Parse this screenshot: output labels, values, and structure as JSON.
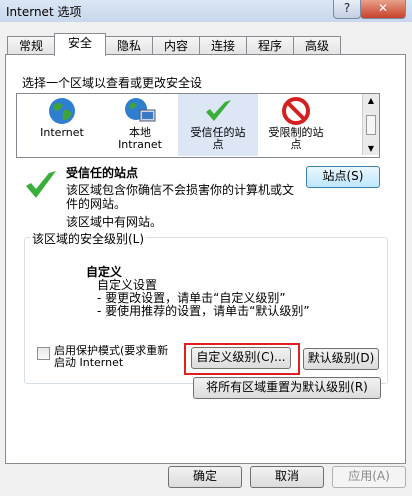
{
  "window": {
    "title": "Internet 选项",
    "help": "?",
    "close": "✕"
  },
  "tabs": [
    "常规",
    "安全",
    "隐私",
    "内容",
    "连接",
    "程序",
    "高级"
  ],
  "select_zone_label": "选择一个区域以查看或更改安全设",
  "zones": [
    {
      "label": "Internet",
      "icon": "globe-icon"
    },
    {
      "label": "本地\nIntranet",
      "icon": "intranet-icon"
    },
    {
      "label": "受信任的站\n点",
      "icon": "checkmark-icon"
    },
    {
      "label": "受限制的站\n点",
      "icon": "restricted-icon"
    }
  ],
  "selected_zone": {
    "title": "受信任的站点",
    "description": "该区域包含你确信不会损害你的计算机或文\n件的网站。",
    "note": "该区域中有网站。",
    "sites_button": "站点(S)"
  },
  "security_level": {
    "group_label": "该区域的安全级别(L)",
    "level_title": "自定义",
    "lines": [
      "自定义设置",
      "- 要更改设置，请单击“自定义级别”",
      "- 要使用推荐的设置，请单击“默认级别”"
    ]
  },
  "protected_mode": {
    "label": "启用保护模式(要求重新\n启动 Internet",
    "checked": false
  },
  "custom_level_button": "自定义级别(C)...",
  "default_level_button": "默认级别(D)",
  "reset_all_button": "将所有区域重置为默认级别(R)",
  "footer": {
    "ok": "确定",
    "cancel": "取消",
    "apply": "应用(A)"
  },
  "colors": {
    "highlight_red": "#e02020",
    "selected_zone": "#dce6f4"
  }
}
